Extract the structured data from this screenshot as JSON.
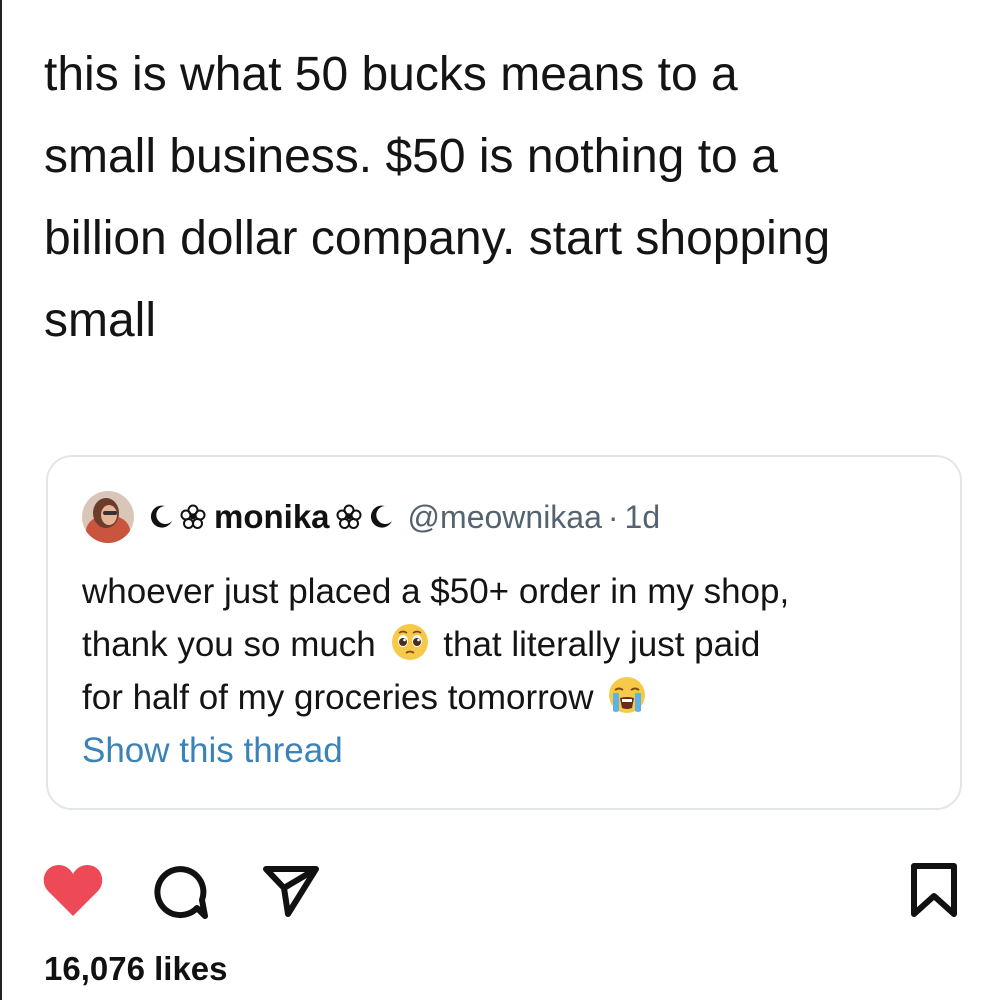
{
  "post": {
    "caption_lines": [
      "this is what 50 bucks means to a",
      "small business. $50 is nothing to a",
      "billion dollar company. start shopping",
      "small"
    ]
  },
  "quoted_tweet": {
    "display_name": "monika",
    "handle": "@meownikaa",
    "separator": "·",
    "age": "1d",
    "body_line_1": "whoever just placed a $50+ order in my shop,",
    "body_line_2a": "thank you so much",
    "body_line_2b": "that literally just paid",
    "body_line_3": "for half of my groceries tomorrow",
    "show_thread_label": "Show this thread",
    "icons": [
      "avatar",
      "moon-icon",
      "flower-icon",
      "pleading-face-emoji",
      "crying-face-emoji"
    ]
  },
  "action_bar": {
    "icons": [
      "heart-icon",
      "comment-icon",
      "share-icon",
      "bookmark-icon"
    ],
    "heart_color": "#ed4956"
  },
  "likes": {
    "text": "16,076 likes"
  },
  "colors": {
    "link": "#3a82b8",
    "secondary_text": "#556370",
    "card_border": "#e3e6e8"
  }
}
